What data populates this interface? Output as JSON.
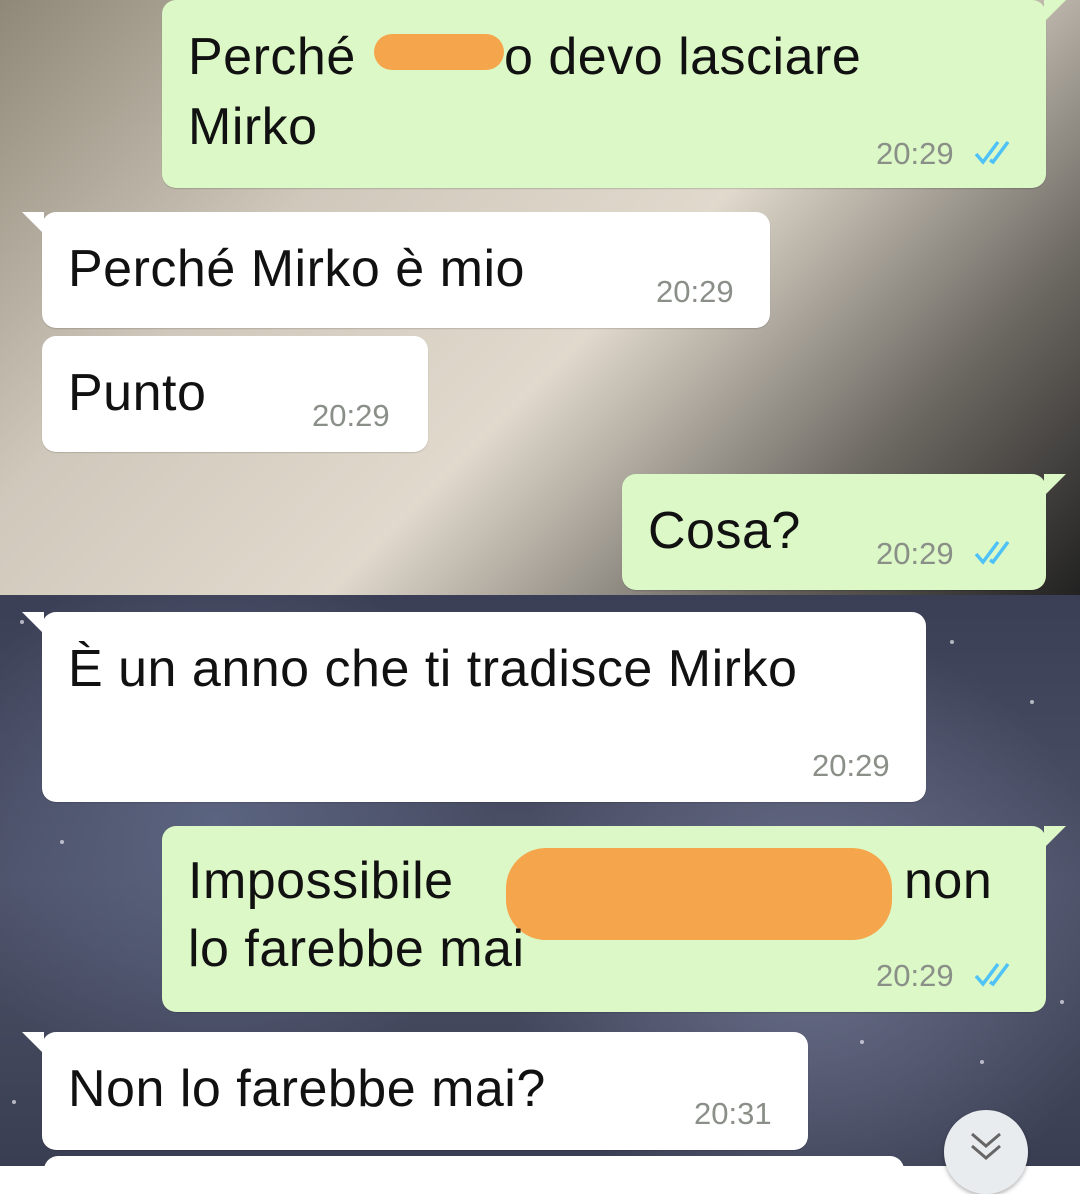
{
  "messages": [
    {
      "direction": "out",
      "text_line1_a": "Perché",
      "text_line1_b": "o devo lasciare",
      "text_line2": "Mirko",
      "time": "20:29",
      "status": "read"
    },
    {
      "direction": "in",
      "text": "Perché Mirko è mio",
      "time": "20:29"
    },
    {
      "direction": "in",
      "text": "Punto",
      "time": "20:29"
    },
    {
      "direction": "out",
      "text": "Cosa?",
      "time": "20:29",
      "status": "read"
    },
    {
      "direction": "in",
      "text": "È un anno che ti tradisce Mirko",
      "time": "20:29"
    },
    {
      "direction": "out",
      "text_line1_a": "Impossibile",
      "text_line1_b": "non",
      "text_line2": "lo farebbe mai",
      "time": "20:29",
      "status": "read"
    },
    {
      "direction": "in",
      "text": "Non lo farebbe mai?",
      "time": "20:31"
    }
  ],
  "colors": {
    "outgoing_bubble": "#dcf8c6",
    "incoming_bubble": "#ffffff",
    "read_ticks": "#4fc3f7",
    "redaction": "#f5a64c"
  },
  "icons": {
    "read_receipt": "double-check-icon",
    "scroll_down": "double-chevron-down-icon"
  }
}
